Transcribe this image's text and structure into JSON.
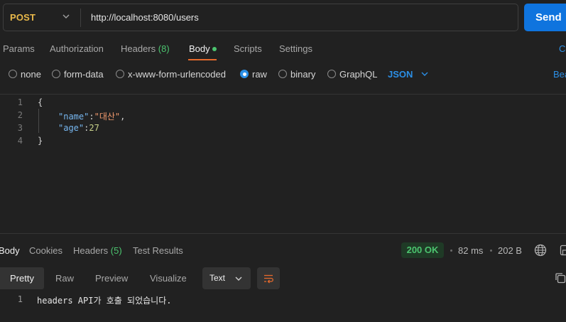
{
  "request": {
    "method": "POST",
    "url": "http://localhost:8080/users",
    "send_label": "Send"
  },
  "request_tabs": {
    "params": "Params",
    "authorization": "Authorization",
    "headers": "Headers",
    "headers_count": "(8)",
    "body": "Body",
    "scripts": "Scripts",
    "settings": "Settings",
    "cookies_cut": "Co"
  },
  "body_types": {
    "none": "none",
    "form_data": "form-data",
    "urlencoded": "x-www-form-urlencoded",
    "raw": "raw",
    "binary": "binary",
    "graphql": "GraphQL",
    "selected": "raw",
    "format": "JSON",
    "beautify_cut": "Bea"
  },
  "editor": {
    "line_numbers": [
      "1",
      "2",
      "3",
      "4"
    ],
    "open_brace": "{",
    "key_name": "\"name\"",
    "colon1": ":",
    "val_name": "\"대산\"",
    "comma": ",",
    "key_age": "\"age\"",
    "colon2": ":",
    "val_age": "27",
    "close_brace": "}"
  },
  "response_tabs": {
    "body": "Body",
    "cookies": "Cookies",
    "headers": "Headers",
    "headers_count": "(5)",
    "test_results": "Test Results"
  },
  "response_meta": {
    "status": "200 OK",
    "time": "82 ms",
    "size": "202 B"
  },
  "response_format": {
    "pretty": "Pretty",
    "raw": "Raw",
    "preview": "Preview",
    "visualize": "Visualize",
    "text_select": "Text"
  },
  "response_body": {
    "line_number": "1",
    "text": "headers API가 호출 되었습니다."
  },
  "colors": {
    "accent_blue": "#0f74de",
    "method_yellow": "#e9b94a",
    "status_green": "#4cc46f",
    "active_tab_orange": "#e56a2c"
  }
}
